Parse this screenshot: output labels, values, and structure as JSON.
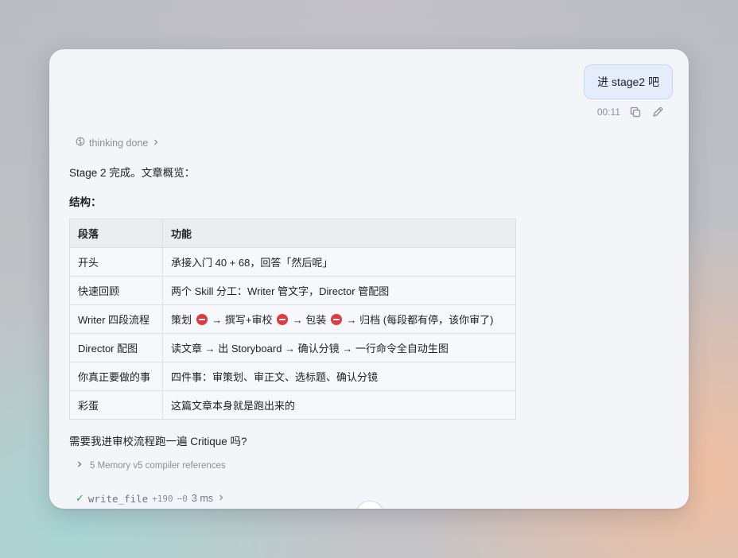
{
  "user_message": {
    "text": "进 stage2 吧",
    "time": "00:11"
  },
  "icons": {
    "copy": "copy-icon",
    "edit": "pencil-icon",
    "thinking": "brain-icon",
    "expand": "chevron-right-icon",
    "check": "check-icon"
  },
  "assistant": {
    "thinking_label": "thinking done",
    "intro": "Stage 2 完成。文章概览：",
    "structure_label": "结构：",
    "table": {
      "headers": [
        "段落",
        "功能"
      ],
      "rows": [
        [
          "开头",
          "承接入门 40 + 68，回答「然后呢」"
        ],
        [
          "快速回顾",
          "两个 Skill 分工：Writer 管文字，Director 管配图"
        ],
        [
          "Writer 四段流程",
          "策划 ⛔ → 撰写+审校 ⛔ → 包装 ⛔ → 归档 (每段都有停，该你审了)"
        ],
        [
          "Director 配图",
          "读文章 → 出 Storyboard → 确认分镜 → 一行命令全自动生图"
        ],
        [
          "你真正要做的事",
          "四件事：审策划、审正文、选标题、确认分镜"
        ],
        [
          "彩蛋",
          "这篇文章本身就是跑出来的"
        ]
      ]
    },
    "question": "需要我进审校流程跑一遍 Critique 吗?",
    "references_label": "5 Memory v5 compiler references",
    "tool_call": {
      "name": "write_file",
      "added": "+190",
      "removed": "−0",
      "duration": "3 ms"
    }
  },
  "colors": {
    "stop": "#e23a3a",
    "check": "#2f9d5a",
    "bubble": "#e5edfd"
  }
}
